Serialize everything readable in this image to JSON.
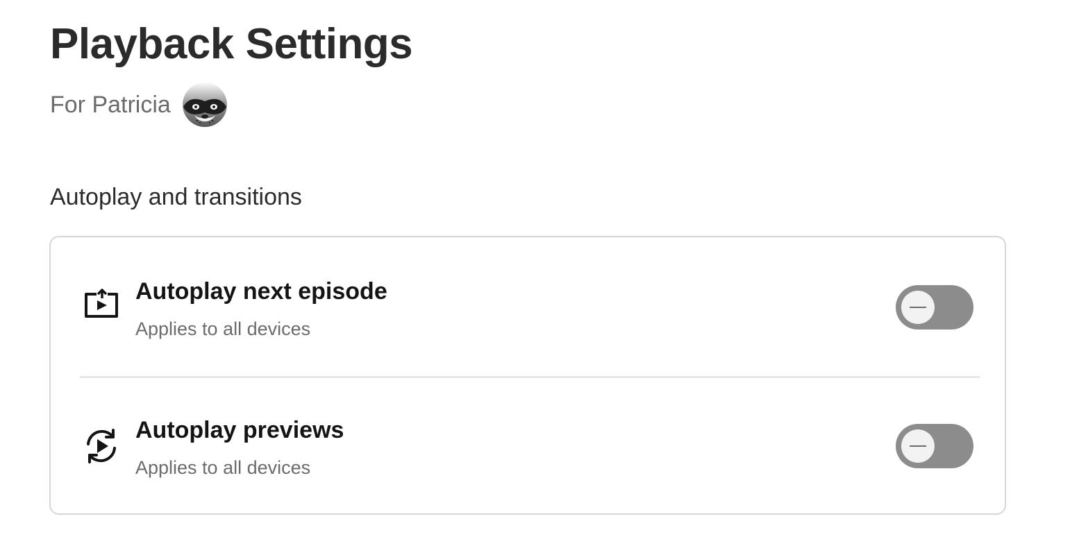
{
  "header": {
    "title": "Playback Settings",
    "profile_label": "For Patricia",
    "avatar_icon": "masked-raccoon-avatar"
  },
  "section": {
    "title": "Autoplay and transitions"
  },
  "settings": [
    {
      "title": "Autoplay next episode",
      "subtitle": "Applies to all devices",
      "icon": "autoplay-next-episode-icon",
      "enabled": false
    },
    {
      "title": "Autoplay previews",
      "subtitle": "Applies to all devices",
      "icon": "autoplay-previews-icon",
      "enabled": false
    }
  ],
  "colors": {
    "toggle_off_track": "#8c8c8c",
    "toggle_knob": "#f2f2f2",
    "title_text": "#2b2b2b",
    "secondary_text": "#6b6b6b",
    "card_border": "#d6d6d6"
  }
}
